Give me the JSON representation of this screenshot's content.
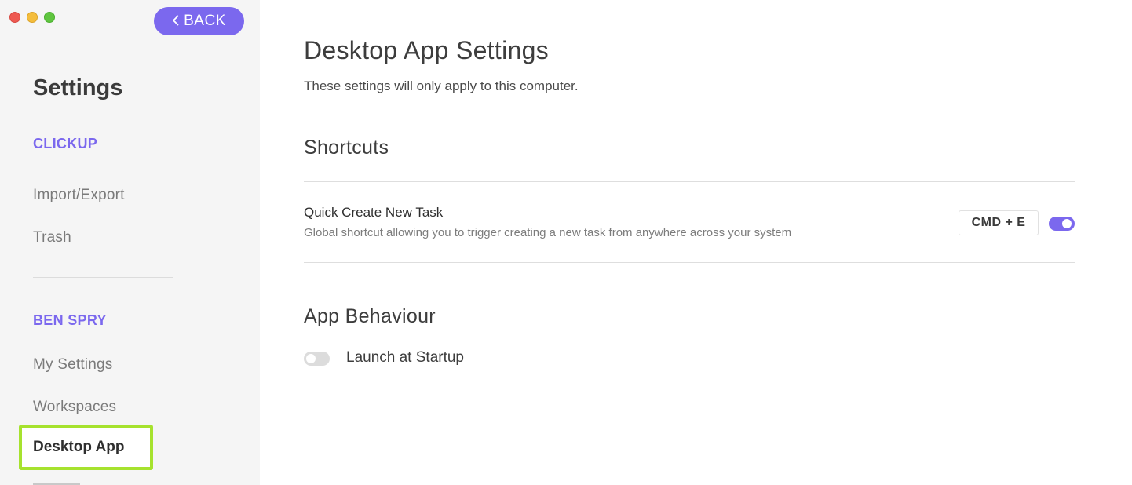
{
  "window": {
    "controls": [
      "close",
      "minimize",
      "zoom"
    ]
  },
  "sidebar": {
    "back_label": "BACK",
    "title": "Settings",
    "sections": [
      {
        "heading": "CLICKUP",
        "items": [
          "Import/Export",
          "Trash"
        ]
      },
      {
        "heading": "BEN SPRY",
        "items": [
          "My Settings",
          "Workspaces",
          "Desktop App"
        ]
      }
    ],
    "active_item": "Desktop App"
  },
  "main": {
    "title": "Desktop App Settings",
    "subtitle": "These settings will only apply to this computer.",
    "shortcuts": {
      "heading": "Shortcuts",
      "rows": [
        {
          "title": "Quick Create New Task",
          "description": "Global shortcut allowing you to trigger creating a new task from anywhere across your system",
          "shortcut": "CMD + E",
          "enabled": true
        }
      ]
    },
    "app_behaviour": {
      "heading": "App Behaviour",
      "options": [
        {
          "label": "Launch at Startup",
          "enabled": false
        }
      ]
    }
  },
  "colors": {
    "accent": "#7b68ee",
    "highlight": "#a6e22e",
    "sidebar_bg": "#f5f5f5"
  }
}
